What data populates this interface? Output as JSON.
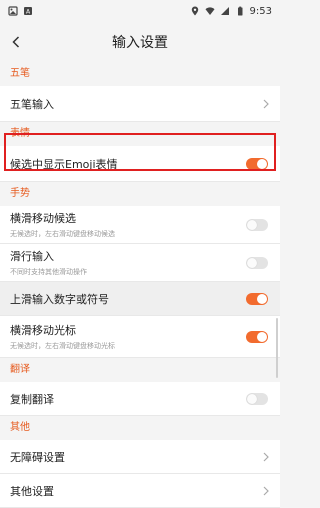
{
  "status": {
    "time": "9:53"
  },
  "header": {
    "title": "输入设置"
  },
  "sections": {
    "wubi": "五笔",
    "emoji": "表情",
    "gesture": "手势",
    "translate": "翻译",
    "other": "其他"
  },
  "rows": {
    "wubi_input": "五笔输入",
    "emoji_label": "候选中显示Emoji表情",
    "swipe_candidates": {
      "label": "横滑移动候选",
      "sub": "无候选时，左右滑动键盘移动候选"
    },
    "glide_input": {
      "label": "滑行输入",
      "sub": "不同时支持其他滑动操作"
    },
    "swipe_up": "上滑输入数字或符号",
    "swipe_cursor": {
      "label": "横滑移动光标",
      "sub": "无候选时，左右滑动键盘移动光标"
    },
    "copy_translate": "复制翻译",
    "accessibility": "无障碍设置",
    "other_settings": "其他设置"
  },
  "toggles": {
    "emoji": true,
    "swipe_candidates": false,
    "glide_input": false,
    "swipe_up": true,
    "swipe_cursor": true,
    "copy_translate": false
  },
  "colors": {
    "accent": "#f26b2e",
    "highlight": "#e02020"
  }
}
